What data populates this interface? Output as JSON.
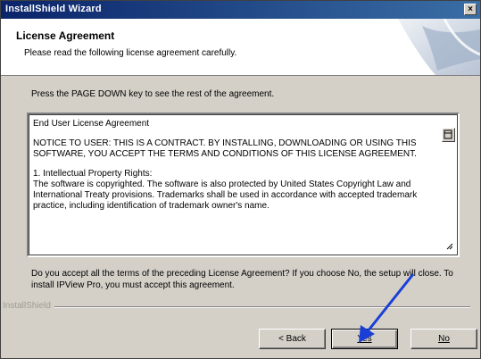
{
  "window": {
    "title": "InstallShield Wizard"
  },
  "header": {
    "title": "License Agreement",
    "subtitle": "Please read the following license agreement carefully."
  },
  "instructions": "Press the PAGE DOWN key to see the rest of the agreement.",
  "license": {
    "heading": "End User License Agreement",
    "notice": "NOTICE TO USER:  THIS IS A CONTRACT.  BY INSTALLING, DOWNLOADING OR USING THIS SOFTWARE, YOU ACCEPT THE TERMS AND CONDITIONS OF THIS LICENSE AGREEMENT.",
    "section_title": "1.  Intellectual Property Rights:",
    "section_body": "The software is copyrighted.  The software is also protected by United States Copyright Law and International Treaty provisions.  Trademarks shall be used in accordance with accepted trademark practice, including identification of trademark owner's name."
  },
  "question": "Do you accept all the terms of the preceding License Agreement?  If you choose No,  the setup will close.  To install IPView Pro, you must accept this agreement.",
  "brand": "InstallShield",
  "buttons": {
    "back": "< Back",
    "yes": "Yes",
    "no": "No"
  },
  "colors": {
    "titlebar": "#0a246a",
    "face": "#d4d0c8",
    "pointer_arrow": "#1a3fd6"
  }
}
